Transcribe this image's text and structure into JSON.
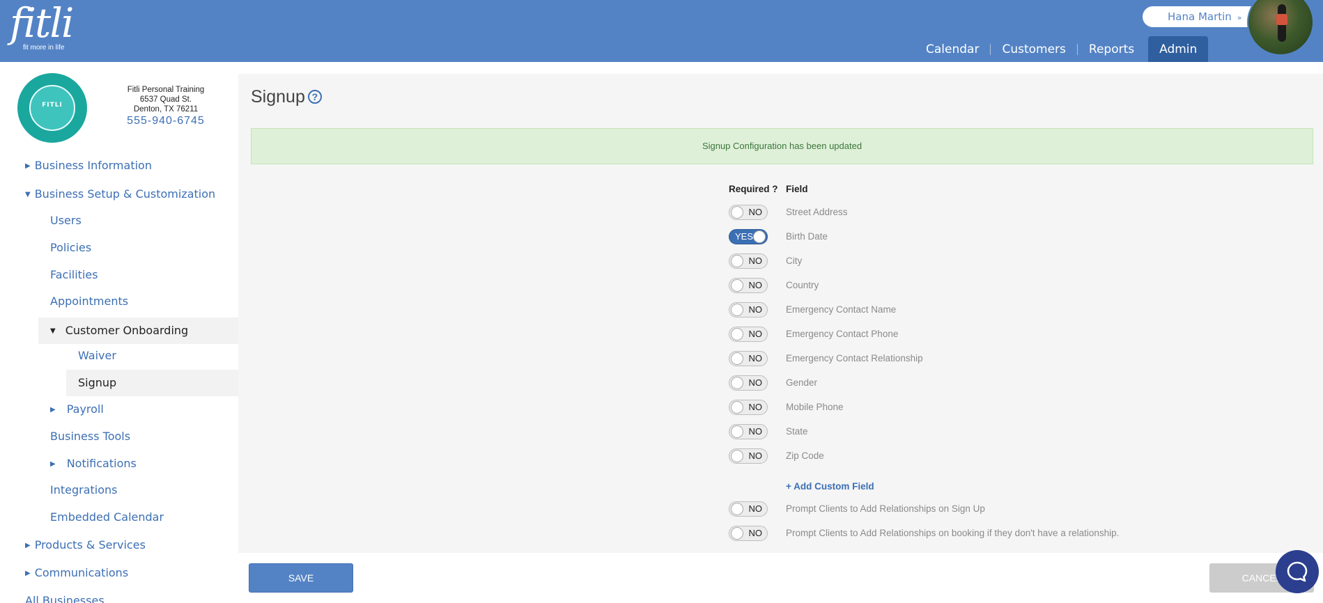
{
  "brand": {
    "name": "fitli",
    "tagline": "fit more in life"
  },
  "user": {
    "name": "Hana Martin",
    "chevron": "»"
  },
  "nav": [
    {
      "label": "Calendar"
    },
    {
      "label": "Customers"
    },
    {
      "label": "Reports"
    },
    {
      "label": "Admin",
      "active": true
    }
  ],
  "business": {
    "logo_text": "FITLI",
    "name": "Fitli Personal Training",
    "street": "6537 Quad St.",
    "city_line": "Denton, TX 76211",
    "phone": "555-940-6745"
  },
  "sidebar": {
    "items": [
      {
        "label": "Business Information"
      },
      {
        "label": "Business Setup & Customization"
      },
      {
        "label": "Users"
      },
      {
        "label": "Policies"
      },
      {
        "label": "Facilities"
      },
      {
        "label": "Appointments"
      },
      {
        "label": "Customer Onboarding"
      },
      {
        "label": "Waiver"
      },
      {
        "label": "Signup"
      },
      {
        "label": "Payroll"
      },
      {
        "label": "Business Tools"
      },
      {
        "label": "Notifications"
      },
      {
        "label": "Integrations"
      },
      {
        "label": "Embedded Calendar"
      },
      {
        "label": "Products & Services"
      },
      {
        "label": "Communications"
      },
      {
        "label": "All Businesses"
      }
    ]
  },
  "main": {
    "title": "Signup",
    "help_glyph": "?",
    "alert": "Signup Configuration has been updated",
    "col_required": "Required ?",
    "col_field": "Field",
    "fields": [
      {
        "label": "Street Address",
        "required": false,
        "toggle": "NO"
      },
      {
        "label": "Birth Date",
        "required": true,
        "toggle": "YES"
      },
      {
        "label": "City",
        "required": false,
        "toggle": "NO"
      },
      {
        "label": "Country",
        "required": false,
        "toggle": "NO"
      },
      {
        "label": "Emergency Contact Name",
        "required": false,
        "toggle": "NO"
      },
      {
        "label": "Emergency Contact Phone",
        "required": false,
        "toggle": "NO"
      },
      {
        "label": "Emergency Contact Relationship",
        "required": false,
        "toggle": "NO"
      },
      {
        "label": "Gender",
        "required": false,
        "toggle": "NO"
      },
      {
        "label": "Mobile Phone",
        "required": false,
        "toggle": "NO"
      },
      {
        "label": "State",
        "required": false,
        "toggle": "NO"
      },
      {
        "label": "Zip Code",
        "required": false,
        "toggle": "NO"
      }
    ],
    "add_custom_field": "+ Add Custom Field",
    "extra": [
      {
        "label": "Prompt Clients to Add Relationships on Sign Up",
        "toggle": "NO"
      },
      {
        "label": "Prompt Clients to Add Relationships on booking if they don't have a relationship.",
        "toggle": "NO"
      }
    ]
  },
  "footer": {
    "save": "SAVE",
    "cancel": "CANCEL"
  },
  "colors": {
    "header": "#5483c5",
    "nav_active": "#2f5f9f",
    "link": "#3c6fb4",
    "alert_bg": "#dff0d8",
    "alert_text": "#3c763d",
    "chat": "#2c3e8e"
  }
}
